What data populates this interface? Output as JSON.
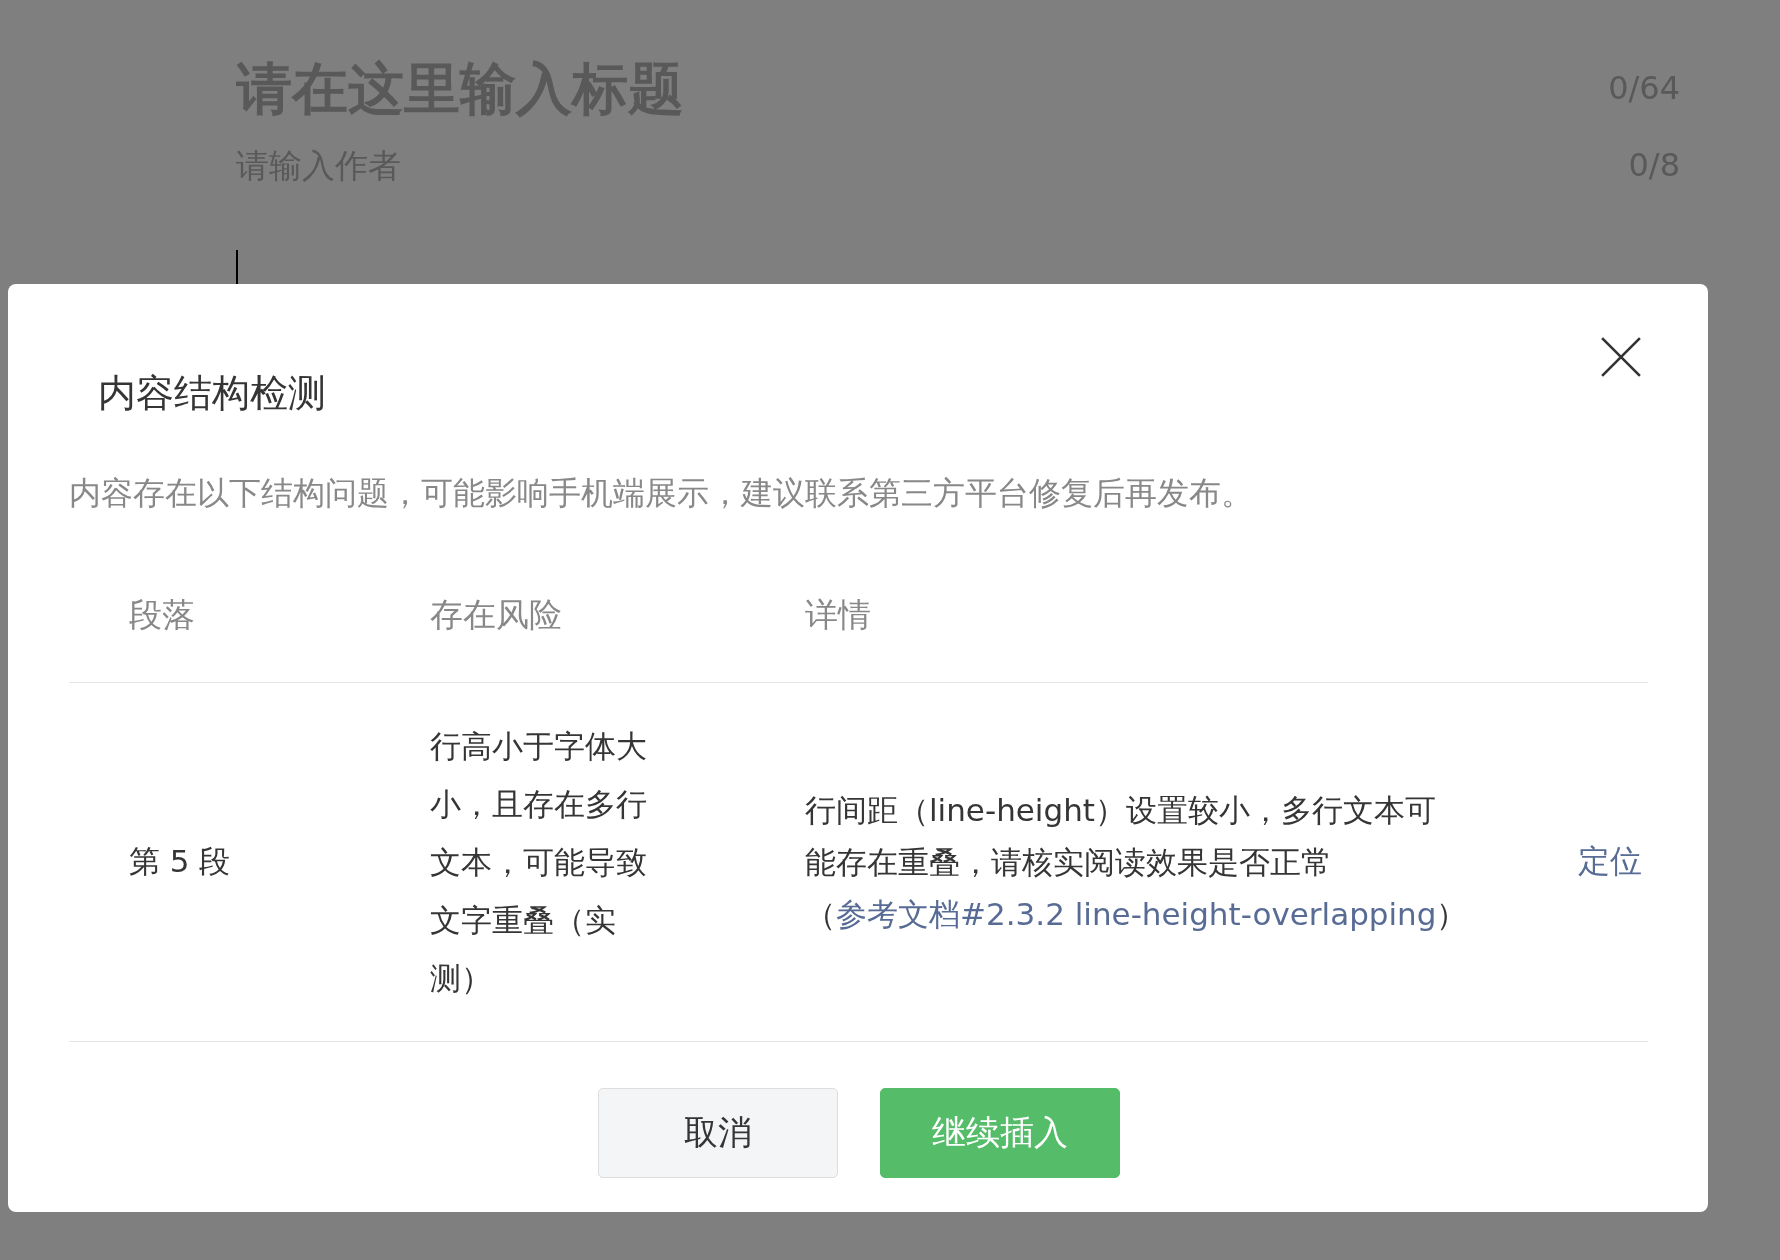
{
  "editor": {
    "title_placeholder": "请在这里输入标题",
    "title_count": "0/64",
    "author_placeholder": "请输入作者",
    "author_count": "0/8"
  },
  "dialog": {
    "title": "内容结构检测",
    "description": "内容存在以下结构问题，可能影响手机端展示，建议联系第三方平台修复后再发布。",
    "table": {
      "columns": [
        "段落",
        "存在风险",
        "详情"
      ],
      "rows": [
        {
          "paragraph": "第 5 段",
          "risk": "行高小于字体大小，且存在多行文本，可能导致文字重叠（实测）",
          "detail": "行间距（line-height）设置较小，多行文本可能存在重叠，请核实阅读效果是否正常（",
          "link": "参考文档#2.3.2 line-height-overlapping",
          "detail_end": "）",
          "action": "定位"
        }
      ]
    },
    "buttons": [
      {
        "label": "取消",
        "kind": "secondary"
      },
      {
        "label": "继续插入",
        "kind": "primary"
      }
    ]
  }
}
